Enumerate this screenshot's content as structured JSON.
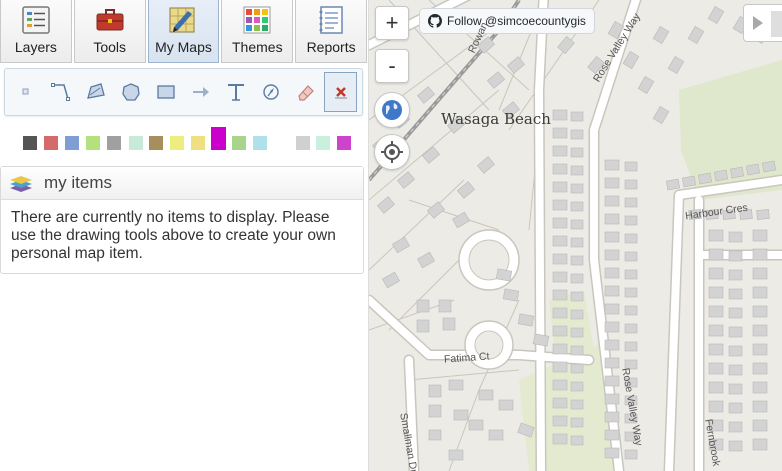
{
  "toolbar": {
    "tabs": [
      {
        "label": "Layers",
        "icon": "layers-icon"
      },
      {
        "label": "Tools",
        "icon": "toolbox-icon"
      },
      {
        "label": "My Maps",
        "icon": "my-maps-icon",
        "active": true
      },
      {
        "label": "Themes",
        "icon": "themes-icon"
      },
      {
        "label": "Reports",
        "icon": "reports-icon"
      }
    ]
  },
  "drawing_tools": [
    {
      "name": "point-tool-icon"
    },
    {
      "name": "line-tool-icon"
    },
    {
      "name": "polygon-tool-icon"
    },
    {
      "name": "circle-tool-icon"
    },
    {
      "name": "rectangle-tool-icon"
    },
    {
      "name": "arrow-tool-icon"
    },
    {
      "name": "text-tool-icon"
    },
    {
      "name": "bearing-tool-icon"
    },
    {
      "name": "eraser-icon"
    },
    {
      "name": "cancel-icon",
      "active": true
    }
  ],
  "colors": {
    "swatches": [
      "#555555",
      "#d46a6a",
      "#7f9fd4",
      "#b4e07e",
      "#a0a0a0",
      "#c8ead8",
      "#a78f5d",
      "#eeee80",
      "#eee080",
      "#cc00cc",
      "#a8d48c",
      "#b0e0ea",
      "#d0d0d0",
      "#c8f0dc",
      "#cc44cc"
    ],
    "selected_index": 9
  },
  "my_items": {
    "title": "my items",
    "empty_message": "There are currently no items to display. Please use the drawing tools above to create your own personal map item."
  },
  "map": {
    "zoom_in": "+",
    "zoom_out": "-",
    "follow_label": "Follow @simcoecountygis",
    "place_label": "Wasaga Beach",
    "street_labels": [
      "Rose Valley Way",
      "Harbour Cres",
      "Fatima Ct",
      "Smallman Dr",
      "Fernbrook",
      "Rose Valley Way",
      "Rowan"
    ],
    "colors": {
      "background": "#ecebe5",
      "road": "#ffffff",
      "road_casing": "#c9c6bd",
      "building": "#d3d3d3",
      "green": "#dfe8cc",
      "rail": "#9a9a9a"
    }
  }
}
